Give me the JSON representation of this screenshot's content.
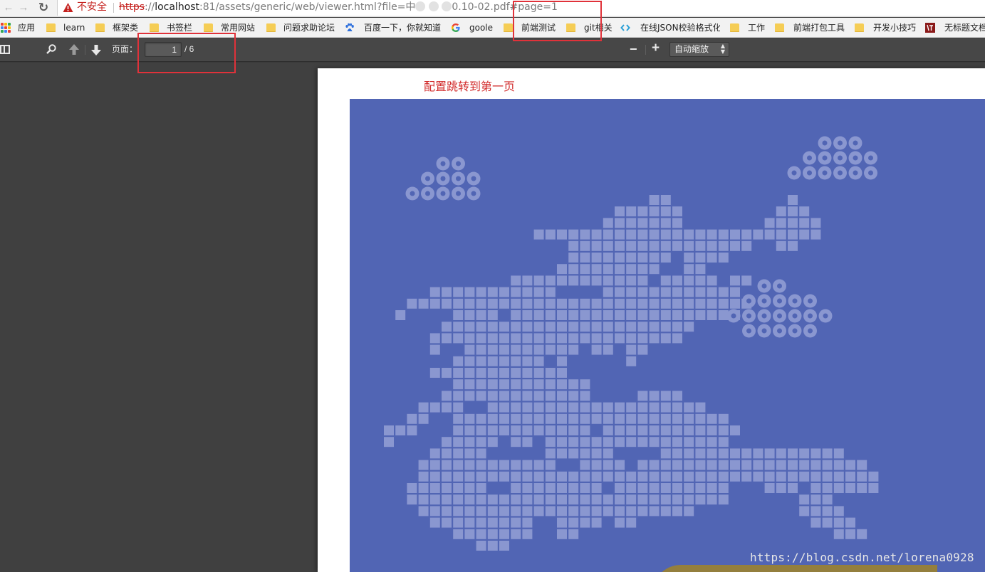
{
  "browser": {
    "security_label": "不安全",
    "url": {
      "scheme": "https",
      "sep": "://",
      "host": "localhost",
      "path_a": ":81/assets/generic/web/viewer.html?file=中",
      "path_b": "0.10-02.pdf#page=1"
    }
  },
  "bookmarks": [
    {
      "label": "应用",
      "icon": "apps-grid-icon"
    },
    {
      "label": "learn",
      "icon": "folder-icon"
    },
    {
      "label": "框架类",
      "icon": "folder-icon"
    },
    {
      "label": "书签栏",
      "icon": "folder-icon"
    },
    {
      "label": "常用网站",
      "icon": "folder-icon"
    },
    {
      "label": "问题求助论坛",
      "icon": "folder-icon"
    },
    {
      "label": "百度一下，你就知道",
      "icon": "baidu-paw-icon"
    },
    {
      "label": "goole",
      "icon": "google-g-icon"
    },
    {
      "label": "前端测试",
      "icon": "folder-icon"
    },
    {
      "label": "git相关",
      "icon": "folder-icon"
    },
    {
      "label": "在线JSON校验格式化",
      "icon": "json-brackets-icon"
    },
    {
      "label": "工作",
      "icon": "folder-icon"
    },
    {
      "label": "前端打包工具",
      "icon": "folder-icon"
    },
    {
      "label": "开发小技巧",
      "icon": "folder-icon"
    },
    {
      "label": "无标题文档",
      "icon": "page-icon"
    }
  ],
  "toolbar": {
    "page_label": "页面：",
    "page_value": "1",
    "page_count": "/ 6",
    "zoom_value": "自动缩放",
    "zoom_out": "−",
    "zoom_in": "+"
  },
  "document": {
    "annotation": "配置跳转到第一页"
  },
  "watermark": "https://blog.csdn.net/lorena0928",
  "colors": {
    "cover_background": "#5165b4",
    "pixel_tile": "#8a97d0",
    "highlight": "#e0323a",
    "accent_bar": "#947f3d"
  }
}
